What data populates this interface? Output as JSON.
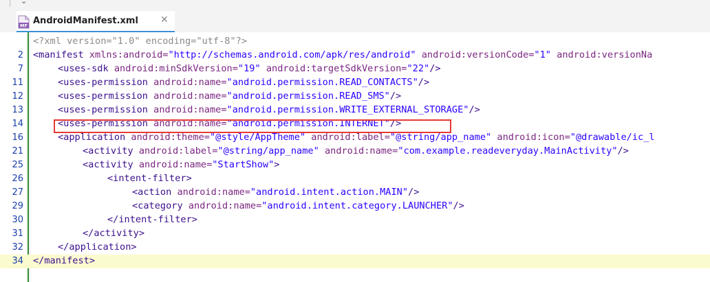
{
  "tab": {
    "title": "AndroidManifest.xml",
    "icon_text": "MF",
    "close": "✕"
  },
  "lines": [
    {
      "num": "",
      "indent": 0,
      "parts": [
        {
          "c": "pi",
          "t": "<?xml version=\"1.0\" encoding=\"utf-8\"?>"
        }
      ]
    },
    {
      "num": "2",
      "indent": 0,
      "parts": [
        {
          "c": "tag",
          "t": "<manifest"
        },
        {
          "c": "attr",
          "t": " xmlns:android="
        },
        {
          "c": "val",
          "t": "\"http://schemas.android.com/apk/res/android\""
        },
        {
          "c": "attr",
          "t": " android:versionCode="
        },
        {
          "c": "val",
          "t": "\"1\""
        },
        {
          "c": "attr",
          "t": " android:versionNa"
        }
      ]
    },
    {
      "num": "7",
      "indent": 1,
      "parts": [
        {
          "c": "tag",
          "t": "<uses-sdk"
        },
        {
          "c": "attr",
          "t": " android:minSdkVersion="
        },
        {
          "c": "val",
          "t": "\"19\""
        },
        {
          "c": "attr",
          "t": " android:targetSdkVersion="
        },
        {
          "c": "val",
          "t": "\"22\""
        },
        {
          "c": "tag",
          "t": "/>"
        }
      ]
    },
    {
      "num": "11",
      "indent": 1,
      "parts": [
        {
          "c": "tag",
          "t": "<uses-permission"
        },
        {
          "c": "attr",
          "t": " android:name="
        },
        {
          "c": "val",
          "t": "\"android.permission.READ_CONTACTS\""
        },
        {
          "c": "tag",
          "t": "/>"
        }
      ]
    },
    {
      "num": "12",
      "indent": 1,
      "parts": [
        {
          "c": "tag",
          "t": "<uses-permission"
        },
        {
          "c": "attr",
          "t": " android:name="
        },
        {
          "c": "val",
          "t": "\"android.permission.READ_SMS\""
        },
        {
          "c": "tag",
          "t": "/>"
        }
      ]
    },
    {
      "num": "13",
      "indent": 1,
      "parts": [
        {
          "c": "tag",
          "t": "<uses-permission"
        },
        {
          "c": "attr",
          "t": " android:name="
        },
        {
          "c": "val",
          "t": "\"android.permission.WRITE_EXTERNAL_STORAGE\""
        },
        {
          "c": "tag",
          "t": "/>"
        }
      ]
    },
    {
      "num": "14",
      "indent": 1,
      "parts": [
        {
          "c": "tag",
          "t": "<uses-permission"
        },
        {
          "c": "attr",
          "t": " android:name="
        },
        {
          "c": "val",
          "t": "\"android.permission.INTERNET\""
        },
        {
          "c": "tag",
          "t": "/>"
        }
      ]
    },
    {
      "num": "16",
      "indent": 1,
      "parts": [
        {
          "c": "tag",
          "t": "<application"
        },
        {
          "c": "attr",
          "t": " android:theme="
        },
        {
          "c": "val",
          "t": "\"@style/AppTheme\""
        },
        {
          "c": "attr",
          "t": " android:label="
        },
        {
          "c": "val",
          "t": "\"@string/app_name\""
        },
        {
          "c": "attr",
          "t": " android:icon="
        },
        {
          "c": "val",
          "t": "\"@drawable/ic_l"
        }
      ]
    },
    {
      "num": "21",
      "indent": 2,
      "parts": [
        {
          "c": "tag",
          "t": "<activity"
        },
        {
          "c": "attr",
          "t": " android:label="
        },
        {
          "c": "val",
          "t": "\"@string/app_name\""
        },
        {
          "c": "attr",
          "t": " android:name="
        },
        {
          "c": "val",
          "t": "\"com.example.readeveryday.MainActivity\""
        },
        {
          "c": "tag",
          "t": "/>"
        }
      ]
    },
    {
      "num": "25",
      "indent": 2,
      "parts": [
        {
          "c": "tag",
          "t": "<activity"
        },
        {
          "c": "attr",
          "t": " android:name="
        },
        {
          "c": "val",
          "t": "\"StartShow\""
        },
        {
          "c": "tag",
          "t": ">"
        }
      ]
    },
    {
      "num": "26",
      "indent": 3,
      "parts": [
        {
          "c": "tag",
          "t": "<intent-filter>"
        }
      ]
    },
    {
      "num": "27",
      "indent": 4,
      "parts": [
        {
          "c": "tag",
          "t": "<action"
        },
        {
          "c": "attr",
          "t": " android:name="
        },
        {
          "c": "val",
          "t": "\"android.intent.action.MAIN\""
        },
        {
          "c": "tag",
          "t": "/>"
        }
      ]
    },
    {
      "num": "29",
      "indent": 4,
      "parts": [
        {
          "c": "tag",
          "t": "<category"
        },
        {
          "c": "attr",
          "t": " android:name="
        },
        {
          "c": "val",
          "t": "\"android.intent.category.LAUNCHER\""
        },
        {
          "c": "tag",
          "t": "/>"
        }
      ]
    },
    {
      "num": "30",
      "indent": 3,
      "parts": [
        {
          "c": "tag",
          "t": "</intent-filter>"
        }
      ]
    },
    {
      "num": "31",
      "indent": 2,
      "parts": [
        {
          "c": "tag",
          "t": "</activity>"
        }
      ]
    },
    {
      "num": "32",
      "indent": 1,
      "parts": [
        {
          "c": "tag",
          "t": "</application>"
        }
      ]
    },
    {
      "num": "34",
      "indent": 0,
      "parts": [
        {
          "c": "tag",
          "t": "</manifest>"
        }
      ]
    }
  ],
  "highlighted_line": "34",
  "boxed_line": "14",
  "colors": {
    "tag": "#3b0f8c",
    "attribute": "#7a2580",
    "value": "#2a00ff",
    "box": "#e53935",
    "current_line": "#fbfbd0",
    "gutter_marker": "#2f8a2f"
  }
}
